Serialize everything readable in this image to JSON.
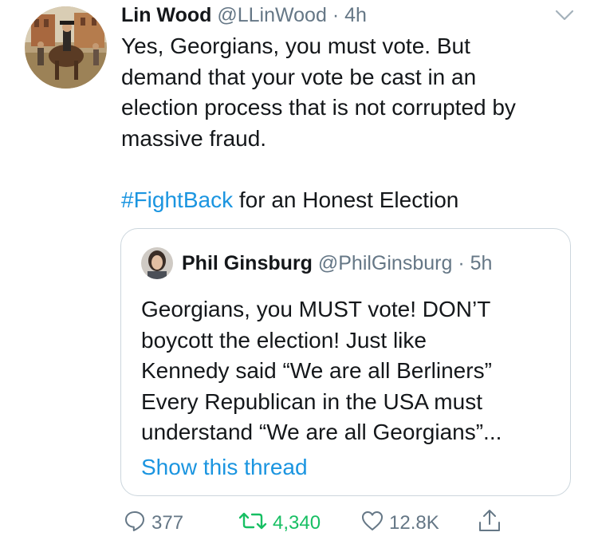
{
  "tweet": {
    "author_name": "Lin Wood",
    "author_handle": "@LLinWood",
    "separator": "·",
    "time": "4h",
    "body_lines": [
      "Yes, Georgians, you must vote. But",
      "demand that your vote be cast in an",
      "election process that is not corrupted by",
      "massive fraud."
    ],
    "hashtag": "#FightBack",
    "hashtag_suffix": " for an Honest Election"
  },
  "quoted": {
    "author_name": "Phil Ginsburg",
    "author_handle": "@PhilGinsburg",
    "separator": "·",
    "time": "5h",
    "body_lines": [
      "Georgians, you MUST vote! DON’T",
      "boycott the election! Just like",
      "Kennedy said “We are all Berliners”",
      "Every Republican in the USA must",
      "understand “We are all Georgians”..."
    ],
    "show_thread": "Show this thread"
  },
  "actions": {
    "replies": "377",
    "retweets": "4,340",
    "likes": "12.8K"
  },
  "icons": {
    "reply": "reply-icon",
    "retweet": "retweet-icon",
    "like": "heart-icon",
    "share": "share-icon",
    "menu": "chevron-down-icon"
  },
  "colors": {
    "link": "#1b95e0",
    "muted": "#657786",
    "retweet_active": "#17bf63",
    "border": "#ccd6dd"
  }
}
